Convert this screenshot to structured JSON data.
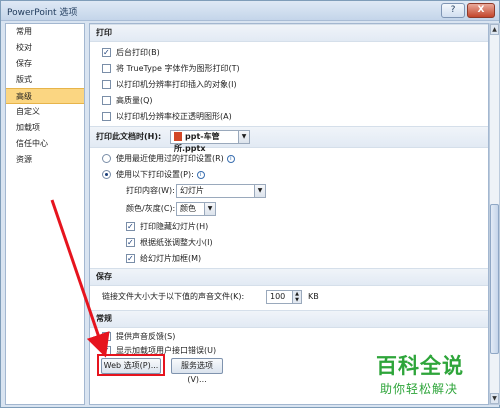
{
  "window": {
    "title": "PowerPoint 选项",
    "help": "?",
    "close": "X"
  },
  "sidebar": {
    "items": [
      {
        "label": "常用"
      },
      {
        "label": "校对"
      },
      {
        "label": "保存"
      },
      {
        "label": "版式"
      },
      {
        "label": "高级"
      },
      {
        "label": "自定义"
      },
      {
        "label": "加载项"
      },
      {
        "label": "信任中心"
      },
      {
        "label": "资源"
      }
    ],
    "active_index": 4
  },
  "print": {
    "header": "打印",
    "options": [
      {
        "label": "后台打印(B)",
        "checked": true
      },
      {
        "label": "将 TrueType 字体作为图形打印(T)",
        "checked": false
      },
      {
        "label": "以打印机分辨率打印插入的对象(I)",
        "checked": false
      },
      {
        "label": "高质量(Q)",
        "checked": false
      },
      {
        "label": "以打印机分辨率校正透明图形(A)",
        "checked": false
      }
    ]
  },
  "print_doc": {
    "header": "打印此文档时(H):",
    "file": "ppt-车管所.pptx",
    "radio_recent": "使用最近使用过的打印设置(R)",
    "radio_following": "使用以下打印设置(P):",
    "print_what_label": "打印内容(W):",
    "print_what_value": "幻灯片",
    "color_label": "颜色/灰度(C):",
    "color_value": "颜色",
    "sub_options": [
      {
        "label": "打印隐藏幻灯片(H)",
        "checked": true
      },
      {
        "label": "根据纸张调整大小(I)",
        "checked": true
      },
      {
        "label": "给幻灯片加框(M)",
        "checked": true
      }
    ]
  },
  "save": {
    "header": "保存",
    "link_label": "链接文件大小大于以下值的声音文件(K):",
    "link_value": "100",
    "unit": "KB"
  },
  "general": {
    "header": "常规",
    "options": [
      {
        "label": "提供声音反馈(S)",
        "checked": true
      },
      {
        "label": "显示加载项用户接口错误(U)",
        "checked": true
      }
    ],
    "web_button": "Web 选项(P)...",
    "service_button": "服务选项(V)..."
  },
  "watermark": {
    "big": "百科全说",
    "small": "助你轻松解决"
  },
  "colors": {
    "accent_red": "#e6141e",
    "sidebar_active": "#fbd682",
    "watermark_green": "#2ea53a"
  }
}
